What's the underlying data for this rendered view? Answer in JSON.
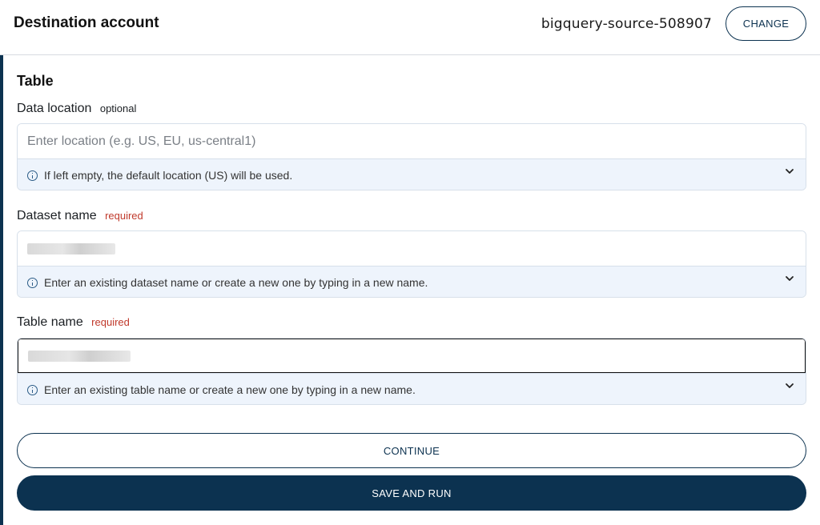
{
  "header": {
    "title": "Destination account",
    "account_name": "bigquery-source-508907",
    "change_label": "CHANGE"
  },
  "section": {
    "title": "Table"
  },
  "fields": {
    "data_location": {
      "label": "Data location",
      "tag": "optional",
      "placeholder": "Enter location (e.g. US, EU, us-central1)",
      "hint": "If left empty, the default location (US) will be used."
    },
    "dataset_name": {
      "label": "Dataset name",
      "tag": "required",
      "hint": "Enter an existing dataset name or create a new one by typing in a new name."
    },
    "table_name": {
      "label": "Table name",
      "tag": "required",
      "hint": "Enter an existing table name or create a new one by typing in a new name."
    }
  },
  "actions": {
    "continue_label": "CONTINUE",
    "save_run_label": "SAVE AND RUN"
  },
  "colors": {
    "primary": "#0c3250",
    "required": "#c0392b",
    "hint_bg": "#eef4fc"
  }
}
